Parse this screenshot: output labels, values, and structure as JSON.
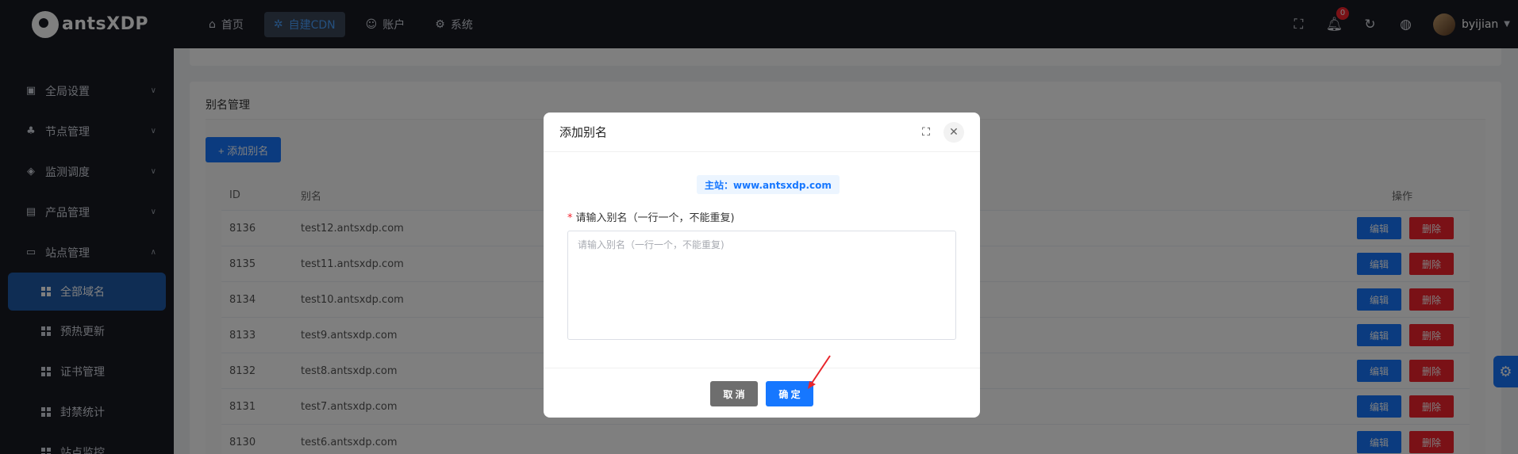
{
  "brand": {
    "name": "antsXDP"
  },
  "topnav": [
    {
      "label": "首页",
      "icon": "home-icon"
    },
    {
      "label": "自建CDN",
      "icon": "cdn-icon",
      "active": true
    },
    {
      "label": "账户",
      "icon": "user-icon"
    },
    {
      "label": "系统",
      "icon": "gear-icon"
    }
  ],
  "header": {
    "notification_count": "0",
    "username": "byijian"
  },
  "sidebar": {
    "items": [
      {
        "label": "全局设置",
        "icon": "settings-icon"
      },
      {
        "label": "节点管理",
        "icon": "node-icon"
      },
      {
        "label": "监测调度",
        "icon": "shield-icon"
      },
      {
        "label": "产品管理",
        "icon": "product-icon"
      },
      {
        "label": "站点管理",
        "icon": "site-icon",
        "expanded": true
      }
    ],
    "subitems": [
      {
        "label": "全部域名",
        "active": true
      },
      {
        "label": "预热更新"
      },
      {
        "label": "证书管理"
      },
      {
        "label": "封禁统计"
      },
      {
        "label": "站点监控"
      }
    ]
  },
  "page": {
    "card_title": "别名管理",
    "add_button": "+ 添加别名",
    "table": {
      "headers": {
        "id": "ID",
        "alias": "别名",
        "ops": "操作"
      },
      "edit_label": "编辑",
      "delete_label": "删除",
      "rows": [
        {
          "id": "8136",
          "alias": "test12.antsxdp.com"
        },
        {
          "id": "8135",
          "alias": "test11.antsxdp.com"
        },
        {
          "id": "8134",
          "alias": "test10.antsxdp.com"
        },
        {
          "id": "8133",
          "alias": "test9.antsxdp.com"
        },
        {
          "id": "8132",
          "alias": "test8.antsxdp.com"
        },
        {
          "id": "8131",
          "alias": "test7.antsxdp.com"
        },
        {
          "id": "8130",
          "alias": "test6.antsxdp.com"
        }
      ]
    }
  },
  "modal": {
    "title": "添加别名",
    "host_tag": "主站：www.antsxdp.com",
    "field_label": "请输入别名（一行一个，不能重复)",
    "field_placeholder": "请输入别名（一行一个，不能重复)",
    "field_value": "",
    "cancel_label": "取 消",
    "ok_label": "确 定"
  },
  "colors": {
    "primary": "#1677ff",
    "danger": "#f5222d",
    "sidebar_bg": "#191a23",
    "active_menu": "#1e5aa8"
  }
}
